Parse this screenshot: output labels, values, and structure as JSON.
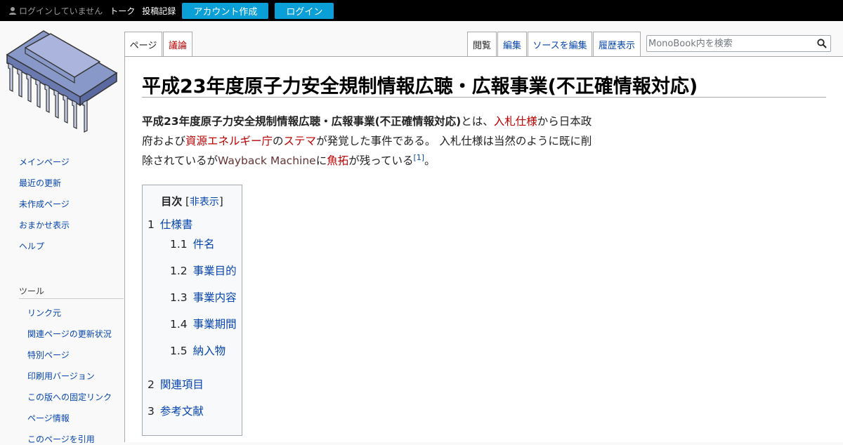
{
  "topbar": {
    "not_logged_in": "ログインしていません",
    "talk": "トーク",
    "contributions": "投稿記録",
    "create_account": "アカウント作成",
    "login": "ログイン"
  },
  "tabs": {
    "page": "ページ",
    "discussion": "議論",
    "read": "閲覧",
    "edit": "編集",
    "edit_source": "ソースを編集",
    "history": "履歴表示"
  },
  "search": {
    "placeholder": "MonoBook内を検索",
    "icon": "search-icon"
  },
  "sidebar": {
    "nav": [
      "メインページ",
      "最近の更新",
      "未作成ページ",
      "おまかせ表示",
      "ヘルプ"
    ],
    "tools_heading": "ツール",
    "tools": [
      "リンク元",
      "関連ページの更新状況",
      "特別ページ",
      "印刷用バージョン",
      "この版への固定リンク",
      "ページ情報",
      "このページを引用"
    ]
  },
  "article": {
    "title": "平成23年度原子力安全規制情報広聴・広報事業(不正確情報対応)",
    "intro": {
      "bold": "平成23年度原子力安全規制情報広聴・広報事業(不正確情報対応)",
      "t1": "とは、",
      "l1": "入札仕様",
      "t2": "から日本政府および",
      "l2": "資源エネルギー庁",
      "t3": "の",
      "l3": "ステマ",
      "t4": "が発覚した事件である。 入札仕様は当然のように既に削除されているが",
      "l4": "Wayback Machine",
      "t5": "に",
      "l5": "魚拓",
      "t6": "が残っている",
      "ref": "[1]",
      "t7": "。"
    }
  },
  "toc": {
    "title": "目次",
    "open_bracket": "[",
    "toggle": "非表示",
    "close_bracket": "]",
    "items": [
      {
        "num": "1",
        "text": "仕様書"
      },
      {
        "num": "1.1",
        "text": "件名"
      },
      {
        "num": "1.2",
        "text": "事業目的"
      },
      {
        "num": "1.3",
        "text": "事業内容"
      },
      {
        "num": "1.4",
        "text": "事業期間"
      },
      {
        "num": "1.5",
        "text": "納入物"
      },
      {
        "num": "2",
        "text": "関連項目"
      },
      {
        "num": "3",
        "text": "参考文献"
      }
    ]
  }
}
